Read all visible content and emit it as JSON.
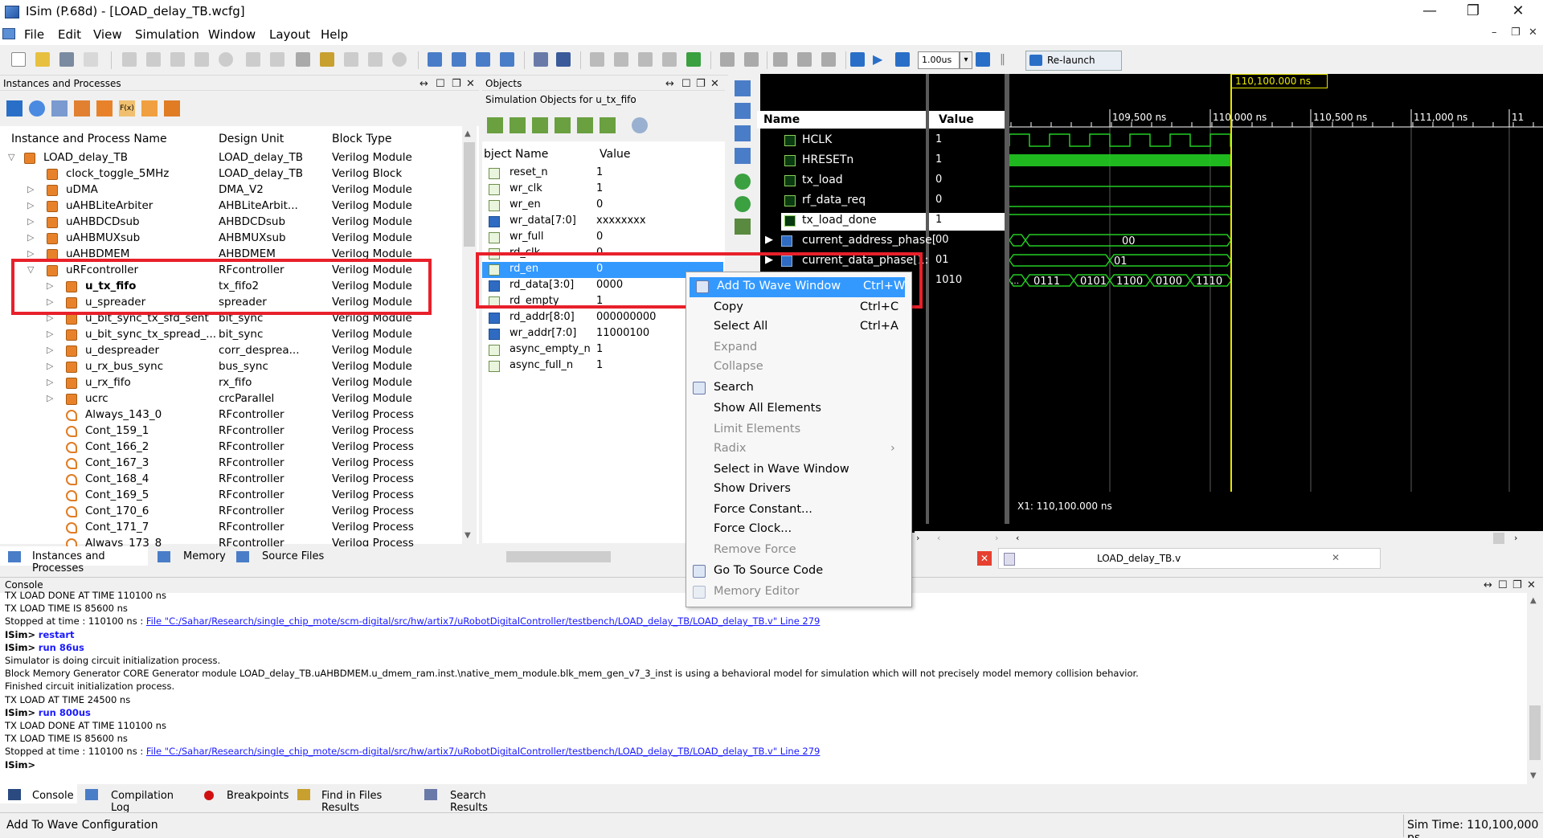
{
  "window": {
    "title": "ISim (P.68d) - [LOAD_delay_TB.wcfg]",
    "controls": [
      "—",
      "❐",
      "✕"
    ]
  },
  "menu": [
    "File",
    "Edit",
    "View",
    "Simulation",
    "Window",
    "Layout",
    "Help"
  ],
  "toolbar": {
    "time_value": "1.00us",
    "relaunch_label": "Re-launch"
  },
  "instances_panel": {
    "title": "Instances and Processes",
    "columns": [
      "Instance and Process Name",
      "Design Unit",
      "Block Type"
    ],
    "rows": [
      {
        "name": "LOAD_delay_TB",
        "unit": "LOAD_delay_TB",
        "type": "Verilog Module",
        "indent": 0,
        "arrow": "▽",
        "kind": "module"
      },
      {
        "name": "clock_toggle_5MHz",
        "unit": "LOAD_delay_TB",
        "type": "Verilog Block",
        "indent": 1,
        "arrow": "",
        "kind": "module"
      },
      {
        "name": "uDMA",
        "unit": "DMA_V2",
        "type": "Verilog Module",
        "indent": 1,
        "arrow": "▷",
        "kind": "module"
      },
      {
        "name": "uAHBLiteArbiter",
        "unit": "AHBLiteArbit...",
        "type": "Verilog Module",
        "indent": 1,
        "arrow": "▷",
        "kind": "module"
      },
      {
        "name": "uAHBDCDsub",
        "unit": "AHBDCDsub",
        "type": "Verilog Module",
        "indent": 1,
        "arrow": "▷",
        "kind": "module"
      },
      {
        "name": "uAHBMUXsub",
        "unit": "AHBMUXsub",
        "type": "Verilog Module",
        "indent": 1,
        "arrow": "▷",
        "kind": "module"
      },
      {
        "name": "uAHBDMEM",
        "unit": "AHBDMEM",
        "type": "Verilog Module",
        "indent": 1,
        "arrow": "▷",
        "kind": "module"
      },
      {
        "name": "uRFcontroller",
        "unit": "RFcontroller",
        "type": "Verilog Module",
        "indent": 1,
        "arrow": "▽",
        "kind": "module"
      },
      {
        "name": "u_tx_fifo",
        "unit": "tx_fifo2",
        "type": "Verilog Module",
        "indent": 2,
        "arrow": "▷",
        "kind": "module",
        "bold": true
      },
      {
        "name": "u_spreader",
        "unit": "spreader",
        "type": "Verilog Module",
        "indent": 2,
        "arrow": "▷",
        "kind": "module"
      },
      {
        "name": "u_bit_sync_tx_sfd_sent",
        "unit": "bit_sync",
        "type": "Verilog Module",
        "indent": 2,
        "arrow": "▷",
        "kind": "module"
      },
      {
        "name": "u_bit_sync_tx_spread_...",
        "unit": "bit_sync",
        "type": "Verilog Module",
        "indent": 2,
        "arrow": "▷",
        "kind": "module"
      },
      {
        "name": "u_despreader",
        "unit": "corr_desprea...",
        "type": "Verilog Module",
        "indent": 2,
        "arrow": "▷",
        "kind": "module"
      },
      {
        "name": "u_rx_bus_sync",
        "unit": "bus_sync",
        "type": "Verilog Module",
        "indent": 2,
        "arrow": "▷",
        "kind": "module"
      },
      {
        "name": "u_rx_fifo",
        "unit": "rx_fifo",
        "type": "Verilog Module",
        "indent": 2,
        "arrow": "▷",
        "kind": "module"
      },
      {
        "name": "ucrc",
        "unit": "crcParallel",
        "type": "Verilog Module",
        "indent": 2,
        "arrow": "▷",
        "kind": "module"
      },
      {
        "name": "Always_143_0",
        "unit": "RFcontroller",
        "type": "Verilog Process",
        "indent": 2,
        "arrow": "",
        "kind": "proc"
      },
      {
        "name": "Cont_159_1",
        "unit": "RFcontroller",
        "type": "Verilog Process",
        "indent": 2,
        "arrow": "",
        "kind": "proc"
      },
      {
        "name": "Cont_166_2",
        "unit": "RFcontroller",
        "type": "Verilog Process",
        "indent": 2,
        "arrow": "",
        "kind": "proc"
      },
      {
        "name": "Cont_167_3",
        "unit": "RFcontroller",
        "type": "Verilog Process",
        "indent": 2,
        "arrow": "",
        "kind": "proc"
      },
      {
        "name": "Cont_168_4",
        "unit": "RFcontroller",
        "type": "Verilog Process",
        "indent": 2,
        "arrow": "",
        "kind": "proc"
      },
      {
        "name": "Cont_169_5",
        "unit": "RFcontroller",
        "type": "Verilog Process",
        "indent": 2,
        "arrow": "",
        "kind": "proc"
      },
      {
        "name": "Cont_170_6",
        "unit": "RFcontroller",
        "type": "Verilog Process",
        "indent": 2,
        "arrow": "",
        "kind": "proc"
      },
      {
        "name": "Cont_171_7",
        "unit": "RFcontroller",
        "type": "Verilog Process",
        "indent": 2,
        "arrow": "",
        "kind": "proc"
      },
      {
        "name": "Always_173_8",
        "unit": "RFcontroller",
        "type": "Verilog Process",
        "indent": 2,
        "arrow": "",
        "kind": "proc"
      }
    ],
    "tabs": [
      "Instances and Processes",
      "Memory",
      "Source Files"
    ]
  },
  "objects_panel": {
    "title": "Objects",
    "subtitle": "Simulation Objects for u_tx_fifo",
    "columns": [
      "bject Name",
      "Value"
    ],
    "rows": [
      {
        "name": "reset_n",
        "value": "1",
        "bus": false
      },
      {
        "name": "wr_clk",
        "value": "1",
        "bus": false
      },
      {
        "name": "wr_en",
        "value": "0",
        "bus": false
      },
      {
        "name": "wr_data[7:0]",
        "value": "xxxxxxxx",
        "bus": true
      },
      {
        "name": "wr_full",
        "value": "0",
        "bus": false
      },
      {
        "name": "rd_clk",
        "value": "0",
        "bus": false
      },
      {
        "name": "rd_en",
        "value": "0",
        "bus": false,
        "selected": true
      },
      {
        "name": "rd_data[3:0]",
        "value": "0000",
        "bus": true
      },
      {
        "name": "rd_empty",
        "value": "1",
        "bus": false
      },
      {
        "name": "rd_addr[8:0]",
        "value": "000000000",
        "bus": true
      },
      {
        "name": "wr_addr[7:0]",
        "value": "11000100",
        "bus": true
      },
      {
        "name": "async_empty_n",
        "value": "1",
        "bus": false
      },
      {
        "name": "async_full_n",
        "value": "1",
        "bus": false
      }
    ]
  },
  "wave": {
    "name_header": "Name",
    "value_header": "Value",
    "cursor_label": "110,100.000 ns",
    "time_ticks": [
      "109,500 ns",
      "110,000 ns",
      "110,500 ns",
      "111,000 ns",
      "11"
    ],
    "cursor_readout": "X1: 110,100.000 ns",
    "signals": [
      {
        "name": "HCLK",
        "value": "1",
        "bus": false,
        "expand": false
      },
      {
        "name": "HRESETn",
        "value": "1",
        "bus": false,
        "expand": false
      },
      {
        "name": "tx_load",
        "value": "0",
        "bus": false,
        "expand": false
      },
      {
        "name": "rf_data_req",
        "value": "0",
        "bus": false,
        "expand": false
      },
      {
        "name": "tx_load_done",
        "value": "1",
        "bus": false,
        "expand": false,
        "selected": true
      },
      {
        "name": "current_address_phase[",
        "value": "00",
        "bus": true,
        "expand": true
      },
      {
        "name": "current_data_phase[1:",
        "value": "01",
        "bus": true,
        "expand": true
      },
      {
        "name": "",
        "value": "1010",
        "bus": true,
        "expand": false
      }
    ],
    "bus_labels": {
      "address": [
        "00"
      ],
      "data": [
        "01"
      ],
      "last": [
        "0111",
        "0101",
        "1100",
        "0100",
        "1110"
      ]
    },
    "file_tab": "LOAD_delay_TB.v"
  },
  "context_menu": {
    "items": [
      {
        "label": "Add To Wave Window",
        "shortcut": "Ctrl+W",
        "highlight": true,
        "disabled": false,
        "icon": "wave-add-icon"
      },
      {
        "label": "Copy",
        "shortcut": "Ctrl+C",
        "highlight": false,
        "disabled": false,
        "icon": ""
      },
      {
        "label": "Select All",
        "shortcut": "Ctrl+A",
        "highlight": false,
        "disabled": false,
        "icon": ""
      },
      {
        "label": "Expand",
        "shortcut": "",
        "highlight": false,
        "disabled": true,
        "icon": ""
      },
      {
        "label": "Collapse",
        "shortcut": "",
        "highlight": false,
        "disabled": true,
        "icon": ""
      },
      {
        "label": "Search",
        "shortcut": "",
        "highlight": false,
        "disabled": false,
        "icon": "search-icon"
      },
      {
        "label": "Show All Elements",
        "shortcut": "",
        "highlight": false,
        "disabled": false,
        "icon": ""
      },
      {
        "label": "Limit Elements",
        "shortcut": "",
        "highlight": false,
        "disabled": true,
        "icon": ""
      },
      {
        "label": "Radix",
        "shortcut": "›",
        "highlight": false,
        "disabled": true,
        "icon": ""
      },
      {
        "label": "Select in Wave Window",
        "shortcut": "",
        "highlight": false,
        "disabled": false,
        "icon": ""
      },
      {
        "label": "Show Drivers",
        "shortcut": "",
        "highlight": false,
        "disabled": false,
        "icon": ""
      },
      {
        "label": "Force Constant...",
        "shortcut": "",
        "highlight": false,
        "disabled": false,
        "icon": ""
      },
      {
        "label": "Force Clock...",
        "shortcut": "",
        "highlight": false,
        "disabled": false,
        "icon": ""
      },
      {
        "label": "Remove Force",
        "shortcut": "",
        "highlight": false,
        "disabled": true,
        "icon": ""
      },
      {
        "label": "Go To Source Code",
        "shortcut": "",
        "highlight": false,
        "disabled": false,
        "icon": "source-code-icon"
      },
      {
        "label": "Memory Editor",
        "shortcut": "",
        "highlight": false,
        "disabled": true,
        "icon": "memory-editor-icon"
      }
    ]
  },
  "console": {
    "title": "Console",
    "lines": [
      {
        "text": "TX LOAD DONE AT TIME          110100 ns",
        "kind": "plain"
      },
      {
        "text": "TX LOAD TIME IS        85600 ns",
        "kind": "plain"
      },
      {
        "prefix": "Stopped at time : 110100 ns : ",
        "link": "File \"C:/Sahar/Research/single_chip_mote/scm-digital/src/hw/artix7/uRobotDigitalController/testbench/LOAD_delay_TB/LOAD_delay_TB.v\" Line 279",
        "kind": "link"
      },
      {
        "prompt": "ISim>",
        "cmd": "restart",
        "kind": "cmd"
      },
      {
        "prompt": "ISim>",
        "cmd": "run 86us",
        "kind": "cmd"
      },
      {
        "text": "Simulator is doing circuit initialization process.",
        "kind": "plain"
      },
      {
        "text": "Block Memory Generator CORE Generator module LOAD_delay_TB.uAHBDMEM.u_dmem_ram.inst.\\native_mem_module.blk_mem_gen_v7_3_inst  is using a behavioral model for simulation which will not precisely model memory collision behavior.",
        "kind": "plain"
      },
      {
        "text": "Finished circuit initialization process.",
        "kind": "plain"
      },
      {
        "text": "TX LOAD AT TIME              24500 ns",
        "kind": "plain"
      },
      {
        "prompt": "ISim>",
        "cmd": "run 800us",
        "kind": "cmd"
      },
      {
        "text": "TX LOAD DONE AT TIME          110100 ns",
        "kind": "plain"
      },
      {
        "text": "TX LOAD TIME IS        85600 ns",
        "kind": "plain"
      },
      {
        "prefix": "Stopped at time : 110100 ns : ",
        "link": "File \"C:/Sahar/Research/single_chip_mote/scm-digital/src/hw/artix7/uRobotDigitalController/testbench/LOAD_delay_TB/LOAD_delay_TB.v\" Line 279",
        "kind": "link"
      },
      {
        "prompt": "ISim>",
        "cmd": "",
        "kind": "cmd"
      }
    ],
    "tabs": [
      "Console",
      "Compilation Log",
      "Breakpoints",
      "Find in Files Results",
      "Search Results"
    ]
  },
  "status": {
    "left": "Add To Wave Configuration",
    "right": "Sim Time: 110,100,000 ps"
  },
  "colors": {
    "highlight": "#3399ff",
    "redbox": "#e8202a",
    "wave_green": "#22cc22",
    "cursor_yellow": "#e6e600"
  }
}
